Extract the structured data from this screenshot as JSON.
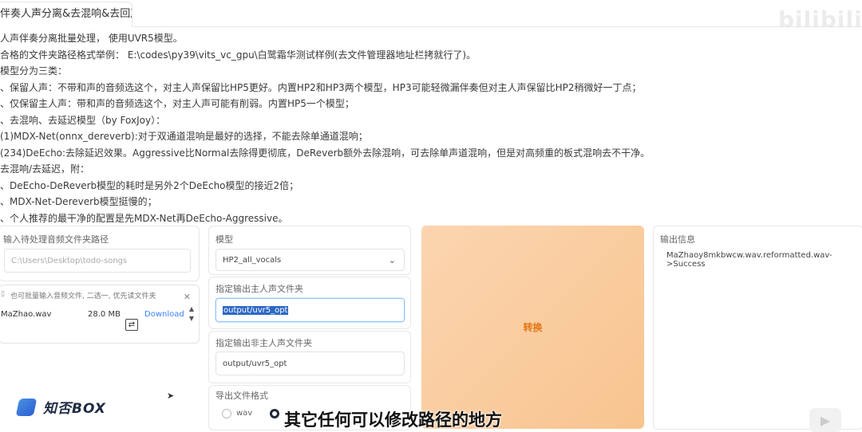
{
  "tab": {
    "label": "伴奏人声分离&去混响&去回声"
  },
  "logo": {
    "text": "bilibili"
  },
  "instructions": [
    "人声伴奏分离批量处理， 使用UVR5模型。",
    "合格的文件夹路径格式举例： E:\\codes\\py39\\vits_vc_gpu\\白鹭霜华测试样例(去文件管理器地址栏拷就行了)。",
    "模型分为三类：",
    "、保留人声：不带和声的音频选这个，对主人声保留比HP5更好。内置HP2和HP3两个模型，HP3可能轻微漏伴奏但对主人声保留比HP2稍微好一丁点；",
    "、仅保留主人声：带和声的音频选这个，对主人声可能有削弱。内置HP5一个模型；",
    "、去混响、去延迟模型（by FoxJoy）：",
    "      (1)MDX-Net(onnx_dereverb):对于双通道混响是最好的选择，不能去除单通道混响；",
    "  (234)DeEcho:去除延迟效果。Aggressive比Normal去除得更彻底，DeReverb额外去除混响，可去除单声道混响，但是对高频重的板式混响去不干净。",
    "去混响/去延迟，附：",
    "、DeEcho-DeReverb模型的耗时是另外2个DeEcho模型的接近2倍；",
    "、MDX-Net-Dereverb模型挺慢的；",
    "、个人推荐的最干净的配置是先MDX-Net再DeEcho-Aggressive。"
  ],
  "input_panel": {
    "label": "输入待处理音频文件夹路径",
    "placeholder": "C:\\Users\\Desktop\\todo-songs"
  },
  "file_upload": {
    "hint": "也可批量输入音频文件, 二选一, 优先读文件夹",
    "file_name": "MaZhao.wav",
    "file_size": "28.0 MB",
    "download_label": "Download"
  },
  "model_panel": {
    "label": "模型",
    "selected": "HP2_all_vocals"
  },
  "vocal_folder": {
    "label": "指定输出主人声文件夹",
    "value": "output/uvr5_opt"
  },
  "instrument_folder": {
    "label": "指定输出非主人声文件夹",
    "value": "output/uvr5_opt"
  },
  "format_panel": {
    "label": "导出文件格式",
    "options": [
      "wav"
    ]
  },
  "convert_button": {
    "label": "转换"
  },
  "output_panel": {
    "label": "输出信息",
    "text": "MaZhaoy8mkbwcw.wav.reformatted.wav->Success"
  },
  "watermark": {
    "text": "知否BOX"
  },
  "subtitle": {
    "text": "其它任何可以修改路径的地方"
  },
  "colors": {
    "accent": "#e27412",
    "button_bg": "#f8c48f",
    "selection": "#2d68c4"
  }
}
